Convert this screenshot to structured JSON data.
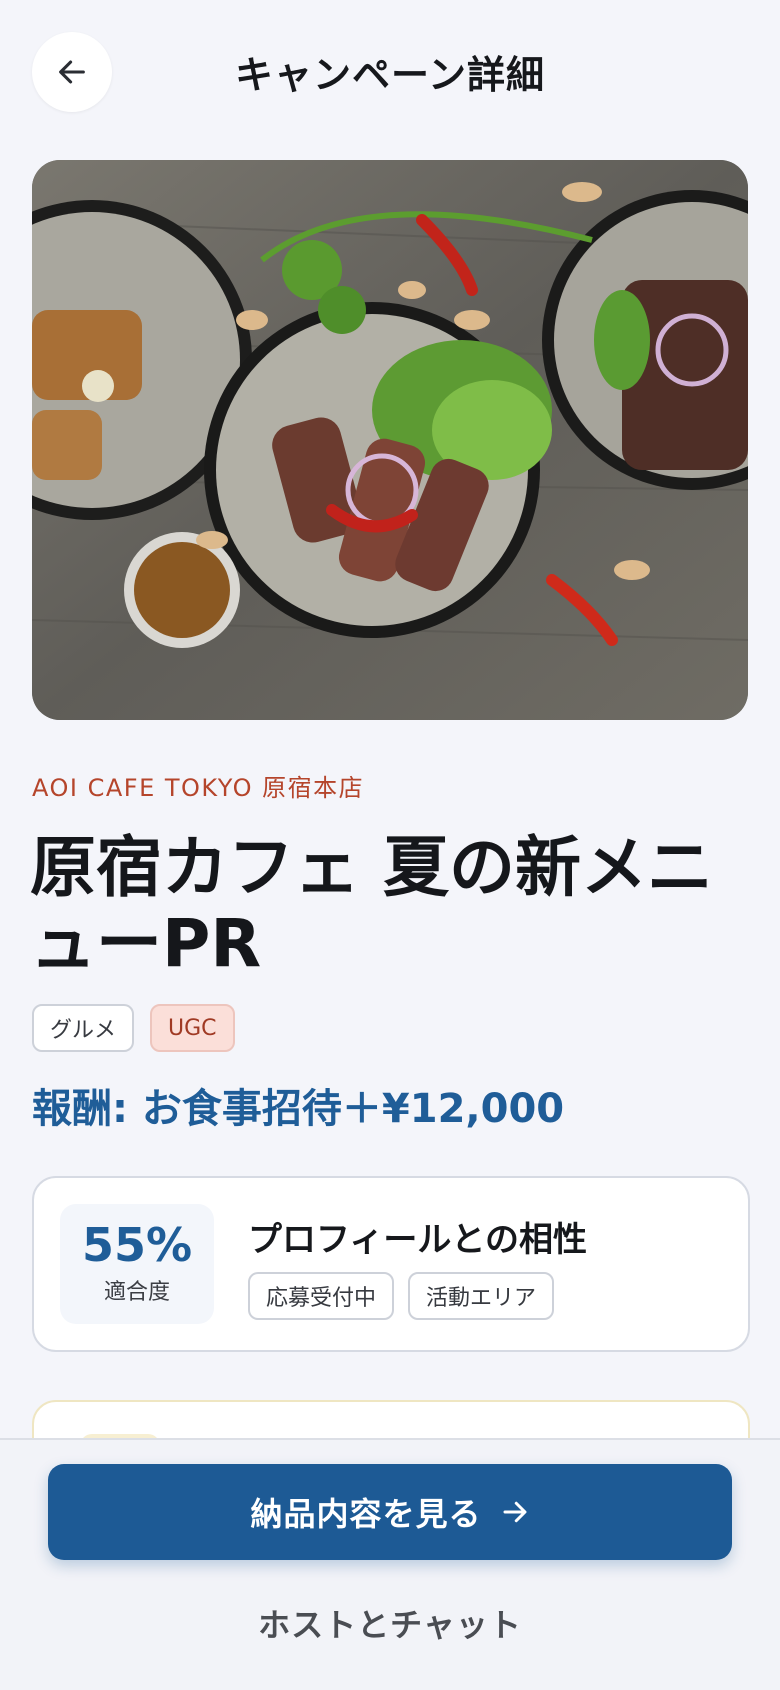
{
  "header": {
    "title": "キャンペーン詳細",
    "back_icon": "arrow-left-icon"
  },
  "hero": {
    "alt": ""
  },
  "campaign": {
    "shop_name": "AOI CAFE TOKYO 原宿本店",
    "title": "原宿カフェ 夏の新メニューPR",
    "tags": [
      "グルメ",
      "UGC"
    ],
    "reward": "報酬: お食事招待＋¥12,000"
  },
  "match": {
    "score": "55%",
    "score_label": "適合度",
    "title": "プロフィールとの相性",
    "chips": [
      "応募受付中",
      "活動エリア"
    ]
  },
  "actions": {
    "primary_label": "納品内容を見る",
    "primary_icon": "arrow-right-icon",
    "secondary_label": "ホストとチャット"
  },
  "colors": {
    "accent": "#1d5a95",
    "brand_text": "#b5452b",
    "ugc_bg": "#fbdfd9"
  }
}
